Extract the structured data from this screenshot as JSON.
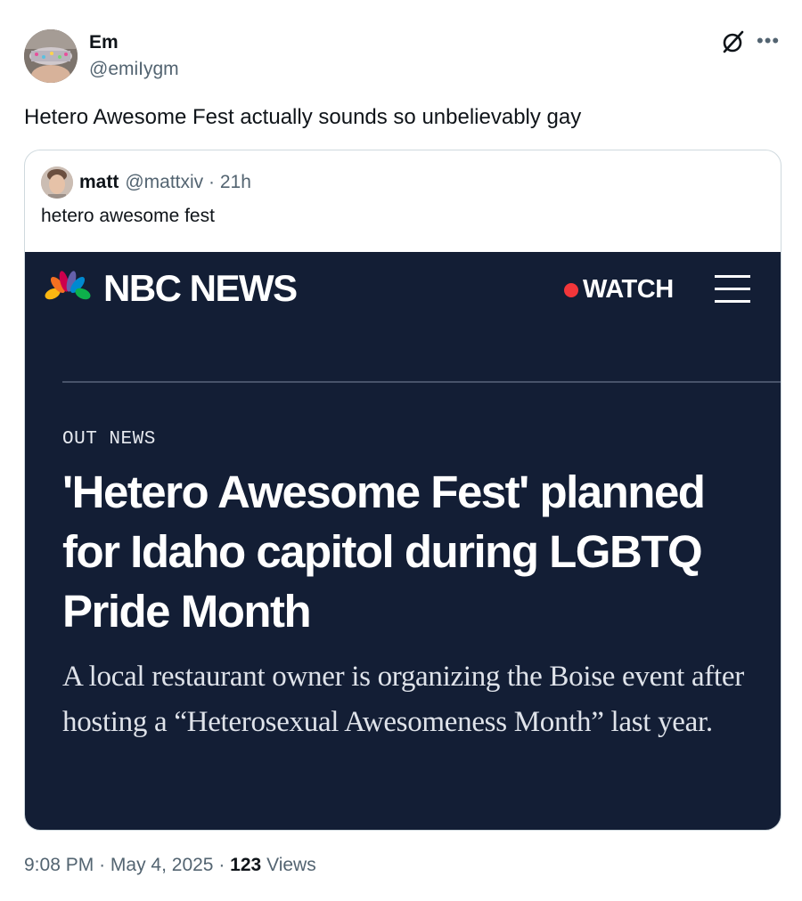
{
  "tweet": {
    "display_name": "Em",
    "handle": "@emiIygm",
    "text": "Hetero Awesome Fest actually sounds so unbelievably gay",
    "time": "9:08 PM",
    "date": "May 4, 2025",
    "sep": "·",
    "views_count": "123",
    "views_label": "Views"
  },
  "quote": {
    "name": "matt",
    "handle_time": "@mattxiv · 21h",
    "text": "hetero awesome fest"
  },
  "article": {
    "brand": "NBC NEWS",
    "watch_label": "WATCH",
    "section": "OUT NEWS",
    "headline": "'Hetero Awesome Fest' planned for Idaho capitol during LGBTQ Pride Month",
    "dek": "A local restaurant owner is organizing the Boise event after hosting a “Heterosexual Awesomeness Month” last year."
  },
  "icons": {
    "grok": "grok-icon",
    "more": "more-icon",
    "menu": "menu-icon",
    "peacock": "nbc-peacock-icon"
  },
  "colors": {
    "text": "#0f1419",
    "secondary": "#536471",
    "border": "#cfd9de",
    "news_bg": "#131e35",
    "watch_dot": "#f2363a"
  }
}
